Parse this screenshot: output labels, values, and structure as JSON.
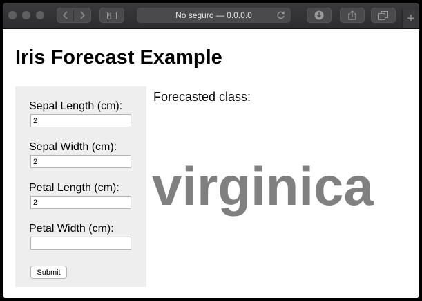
{
  "browser": {
    "address_text": "No seguro — 0.0.0.0",
    "new_tab_label": "+"
  },
  "page": {
    "title": "Iris Forecast Example",
    "form": {
      "fields": [
        {
          "label": "Sepal Length (cm):",
          "value": "2"
        },
        {
          "label": "Sepal Width (cm):",
          "value": "2"
        },
        {
          "label": "Petal Length (cm):",
          "value": "2"
        },
        {
          "label": "Petal Width (cm):",
          "value": ""
        }
      ],
      "submit_label": "Submit"
    },
    "forecast_label": "Forecasted class:",
    "forecast_value": "virginica"
  }
}
